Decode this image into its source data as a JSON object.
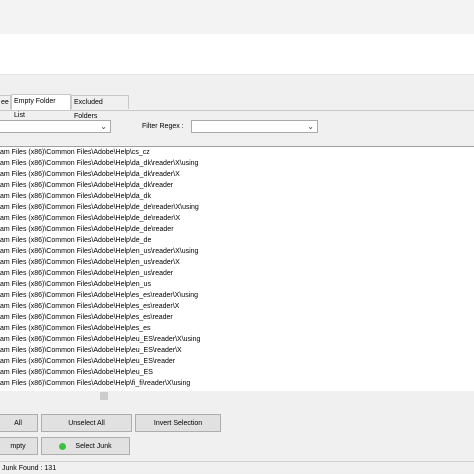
{
  "tabs": [
    {
      "label": "ee"
    },
    {
      "label": "Empty Folder List"
    },
    {
      "label": "Excluded Folders"
    }
  ],
  "filter_regex_label": "Filter Regex :",
  "paths": [
    "am Files (x86)\\Common Files\\Adobe\\Help\\cs_cz",
    "am Files (x86)\\Common Files\\Adobe\\Help\\da_dk\\reader\\X\\using",
    "am Files (x86)\\Common Files\\Adobe\\Help\\da_dk\\reader\\X",
    "am Files (x86)\\Common Files\\Adobe\\Help\\da_dk\\reader",
    "am Files (x86)\\Common Files\\Adobe\\Help\\da_dk",
    "am Files (x86)\\Common Files\\Adobe\\Help\\de_de\\reader\\X\\using",
    "am Files (x86)\\Common Files\\Adobe\\Help\\de_de\\reader\\X",
    "am Files (x86)\\Common Files\\Adobe\\Help\\de_de\\reader",
    "am Files (x86)\\Common Files\\Adobe\\Help\\de_de",
    "am Files (x86)\\Common Files\\Adobe\\Help\\en_us\\reader\\X\\using",
    "am Files (x86)\\Common Files\\Adobe\\Help\\en_us\\reader\\X",
    "am Files (x86)\\Common Files\\Adobe\\Help\\en_us\\reader",
    "am Files (x86)\\Common Files\\Adobe\\Help\\en_us",
    "am Files (x86)\\Common Files\\Adobe\\Help\\es_es\\reader\\X\\using",
    "am Files (x86)\\Common Files\\Adobe\\Help\\es_es\\reader\\X",
    "am Files (x86)\\Common Files\\Adobe\\Help\\es_es\\reader",
    "am Files (x86)\\Common Files\\Adobe\\Help\\es_es",
    "am Files (x86)\\Common Files\\Adobe\\Help\\eu_ES\\reader\\X\\using",
    "am Files (x86)\\Common Files\\Adobe\\Help\\eu_ES\\reader\\X",
    "am Files (x86)\\Common Files\\Adobe\\Help\\eu_ES\\reader",
    "am Files (x86)\\Common Files\\Adobe\\Help\\eu_ES",
    "am Files (x86)\\Common Files\\Adobe\\Help\\fi_fi\\reader\\X\\using"
  ],
  "buttons": {
    "select_all": "All",
    "unselect_all": "Unselect All",
    "invert_selection": "Invert Selection",
    "empty": "mpty",
    "select_junk": "Select Junk"
  },
  "status": "Junk Found : 131",
  "colors": {
    "select_junk_indicator": "#3cc13c",
    "panel": "#f0f0f0"
  }
}
